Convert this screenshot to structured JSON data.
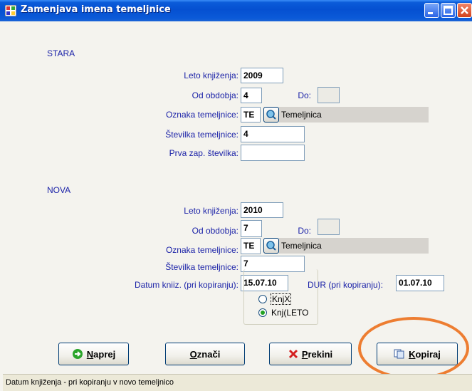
{
  "window": {
    "title": "Zamenjava imena temeljnice"
  },
  "stara": {
    "section_label": "STARA",
    "leto_label": "Leto knjiženja:",
    "leto_value": "2009",
    "od_label": "Od obdobja:",
    "od_value": "4",
    "do_label": "Do:",
    "do_value": "",
    "oznaka_label": "Oznaka temeljnice:",
    "oznaka_value": "TE",
    "oznaka_desc": "Temeljnica",
    "stevilka_label": "Številka temeljnice:",
    "stevilka_value": "4",
    "prva_label": "Prva zap. številka:",
    "prva_value": ""
  },
  "nova": {
    "section_label": "NOVA",
    "leto_label": "Leto knjiženja:",
    "leto_value": "2010",
    "od_label": "Od obdobja:",
    "od_value": "7",
    "do_label": "Do:",
    "do_value": "",
    "oznaka_label": "Oznaka temeljnice:",
    "oznaka_value": "TE",
    "oznaka_desc": "Temeljnica",
    "stevilka_label": "Številka temeljnice:",
    "stevilka_value": "7",
    "datum_label": "Datum kniiz. (pri kopiranju):",
    "datum_value": "15.07.10",
    "dur_label": "DUR (pri kopiranju):",
    "dur_value": "01.07.10",
    "radio_options": [
      {
        "label": "KnjX",
        "selected": false
      },
      {
        "label": "Knj(LETO",
        "selected": true
      }
    ]
  },
  "buttons": {
    "naprej_first": "N",
    "naprej_rest": "aprej",
    "oznaci_first": "O",
    "oznaci_rest": "znači",
    "prekini_first": "P",
    "prekini_rest": "rekini",
    "kopiraj_first": "K",
    "kopiraj_rest": "opiraj"
  },
  "status": {
    "text": "Datum knjiženja - pri kopiranju v novo temeljnico"
  },
  "colors": {
    "label": "#1c23a8",
    "titlebar": "#0550d1",
    "highlight": "#ed7d31",
    "naprej_icon": "#2aa52a",
    "prekini_icon": "#d42020"
  }
}
